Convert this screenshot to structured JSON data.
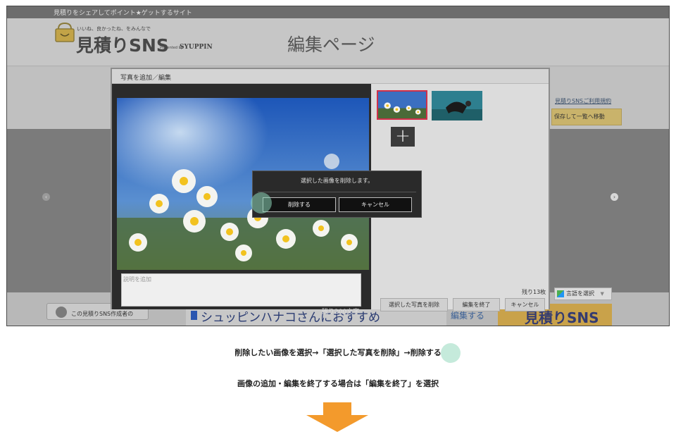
{
  "site": {
    "tagline": "見積りをシェアしてポイント★ゲットするサイト",
    "logo_small": "いいね、良かったね、をみんなで",
    "logo_main": "見積りSNS",
    "logo_presented": "Presented by",
    "logo_brand": "SYUPPIN",
    "page_heading": "編集ページ",
    "side_link": "見積りSNSご利用規約",
    "save_return": "保存して一覧へ移動",
    "creator_label": "この見積りSNS作成者の",
    "recommend_text": "シュッピンハナコさんにおすすめ",
    "edit_link": "編集する",
    "mitsumori_banner": "見積りSNS",
    "language_selector": "言語を選択",
    "language_caret": "▼",
    "arrow_left": "‹",
    "arrow_right": "›"
  },
  "modal": {
    "title": "写真を追加／編集",
    "description_placeholder": "説明を追加",
    "char_count": "残り200文字",
    "remaining_count": "残り13枚",
    "add_photo": "+",
    "delete_selected": "選択した写真を削除",
    "finish_edit": "編集を終了",
    "cancel": "キャンセル"
  },
  "confirm": {
    "message": "選択した画像を削除します。",
    "delete": "削除する",
    "cancel": "キャンセル"
  },
  "instructions": {
    "line1": "削除したい画像を選択→「選択した写真を削除」→削除する",
    "line2": "画像の追加・編集を終了する場合は「編集を終了」を選択"
  },
  "colors": {
    "accent_orange": "#f39a2c",
    "tap_highlight": "#8cd6b8",
    "selected_thumb_border": "#d0304a"
  }
}
